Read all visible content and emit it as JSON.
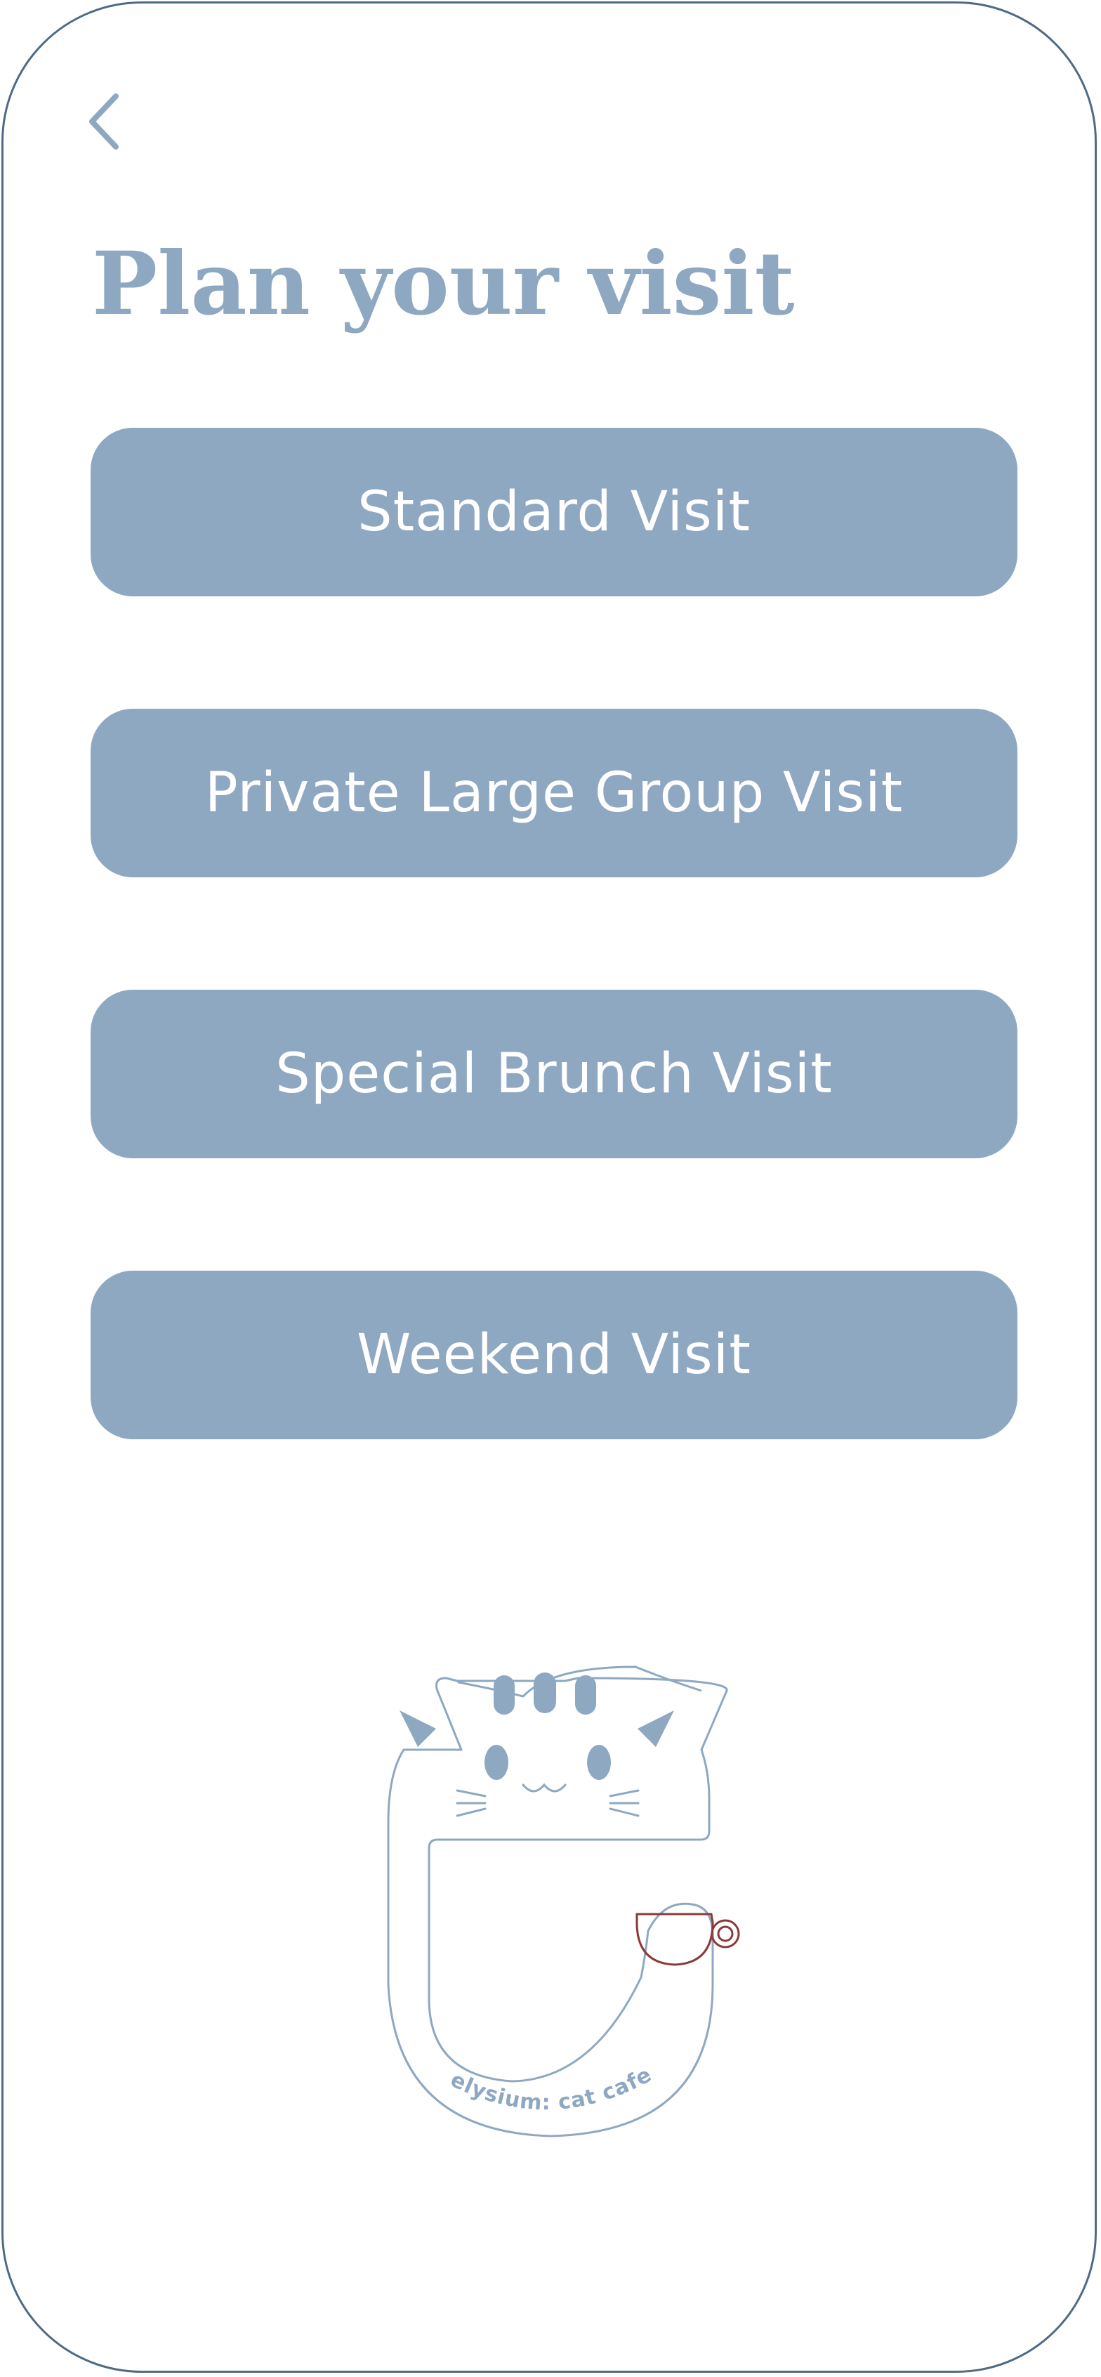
{
  "header": {
    "back_icon": "chevron-left-icon",
    "title": "Plan your visit"
  },
  "visit_options": [
    {
      "label": "Standard Visit"
    },
    {
      "label": "Private Large Group Visit"
    },
    {
      "label": "Special Brunch Visit"
    },
    {
      "label": "Weekend Visit"
    }
  ],
  "logo": {
    "text": "elysium: cat cafe",
    "icon": "cat-cup-logo-icon"
  },
  "colors": {
    "accent": "#8ea8c2",
    "frame": "#4f6b84",
    "cup": "#8b3a3a",
    "background": "#ffffff",
    "button_text": "#ffffff"
  }
}
